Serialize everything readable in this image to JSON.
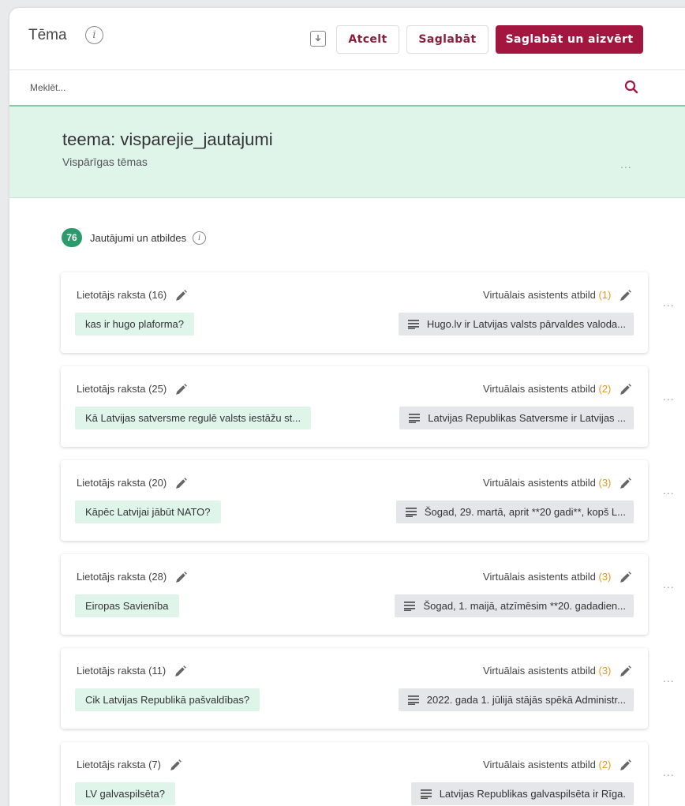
{
  "header": {
    "title": "Tēma",
    "info_glyph": "i",
    "cancel_label": "Atcelt",
    "save_label": "Saglabāt",
    "save_close_label": "Saglabāt un aizvērt"
  },
  "search": {
    "placeholder": "Meklēt..."
  },
  "topic": {
    "title": "teema: visparejie_jautajumi",
    "subtitle": "Vispārīgas tēmas",
    "more": "..."
  },
  "qa": {
    "count": "76",
    "label": "Jautājumi un atbildes",
    "info_glyph": "i"
  },
  "cards": [
    {
      "user_label": "Lietotājs raksta",
      "user_count": "(16)",
      "asst_label": "Virtuālais asistents atbild",
      "asst_count": "(1)",
      "question": "kas ir hugo plaforma?",
      "answer": "Hugo.lv ir Latvijas valsts pārvaldes valoda..."
    },
    {
      "user_label": "Lietotājs raksta",
      "user_count": "(25)",
      "asst_label": "Virtuālais asistents atbild",
      "asst_count": "(2)",
      "question": "Kā Latvijas satversme regulē valsts iestāžu st...",
      "answer": "Latvijas Republikas Satversme ir Latvijas ..."
    },
    {
      "user_label": "Lietotājs raksta",
      "user_count": "(20)",
      "asst_label": "Virtuālais asistents atbild",
      "asst_count": "(3)",
      "question": "Kāpēc Latvijai jābūt NATO?",
      "answer": "Šogad, 29. martā, aprit **20 gadi**, kopš L..."
    },
    {
      "user_label": "Lietotājs raksta",
      "user_count": "(28)",
      "asst_label": "Virtuālais asistents atbild",
      "asst_count": "(3)",
      "question": "Eiropas Savienība",
      "answer": "Šogad, 1. maijā, atzīmēsim **20. gadadien..."
    },
    {
      "user_label": "Lietotājs raksta",
      "user_count": "(11)",
      "asst_label": "Virtuālais asistents atbild",
      "asst_count": "(3)",
      "question": "Cik Latvijas Republikā pašvaldības?",
      "answer": "2022. gada 1. jūlijā stājās spēkā Administr..."
    },
    {
      "user_label": "Lietotājs raksta",
      "user_count": "(7)",
      "asst_label": "Virtuālais asistents atbild",
      "asst_count": "(2)",
      "question": "LV galvaspilsēta?",
      "answer": "Latvijas Republikas galvaspilsēta ir Rīga."
    }
  ],
  "row_more": "...",
  "colors": {
    "brand": "#a3163f",
    "brand_text": "#8c1e3c",
    "topic_bg": "#dff5ea",
    "badge": "#2c9a6c",
    "asst_count": "#e69a24",
    "search_icon": "#a3163f"
  },
  "icons": [
    "info-icon",
    "download-icon",
    "search-icon",
    "pencil-icon",
    "lines-icon",
    "more-icon"
  ]
}
